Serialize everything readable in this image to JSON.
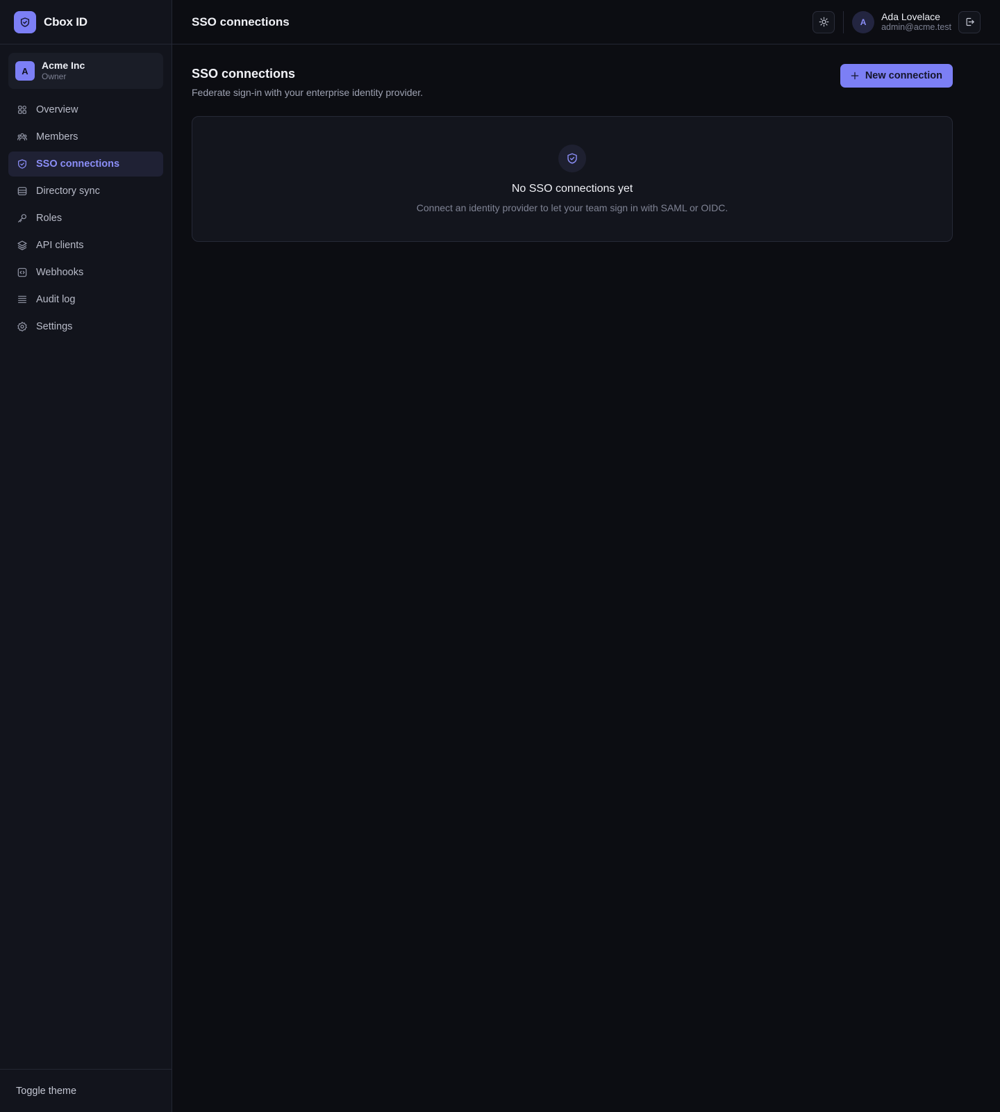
{
  "brand": {
    "name": "Cbox ID",
    "logo_icon": "shield-check-icon",
    "accent": "#7c7ff5"
  },
  "org": {
    "avatar_letter": "A",
    "name": "Acme Inc",
    "role": "Owner"
  },
  "sidebar": {
    "items": [
      {
        "label": "Overview",
        "icon": "grid-icon",
        "active": false
      },
      {
        "label": "Members",
        "icon": "users-icon",
        "active": false
      },
      {
        "label": "SSO connections",
        "icon": "shield-check-icon",
        "active": true
      },
      {
        "label": "Directory sync",
        "icon": "database-icon",
        "active": false
      },
      {
        "label": "Roles",
        "icon": "key-icon",
        "active": false
      },
      {
        "label": "API clients",
        "icon": "layers-icon",
        "active": false
      },
      {
        "label": "Webhooks",
        "icon": "code-square-icon",
        "active": false
      },
      {
        "label": "Audit log",
        "icon": "list-icon",
        "active": false
      },
      {
        "label": "Settings",
        "icon": "gear-icon",
        "active": false
      }
    ],
    "footer_label": "Toggle theme"
  },
  "topbar": {
    "title": "SSO connections",
    "theme_icon": "sun-icon",
    "user": {
      "avatar_letter": "A",
      "name": "Ada Lovelace",
      "email": "admin@acme.test"
    },
    "logout_icon": "logout-icon"
  },
  "page": {
    "title": "SSO connections",
    "subtitle": "Federate sign-in with your enterprise identity provider.",
    "new_button_label": "New connection"
  },
  "empty_state": {
    "title": "No SSO connections yet",
    "description": "Connect an identity provider to let your team sign in with SAML or OIDC."
  }
}
